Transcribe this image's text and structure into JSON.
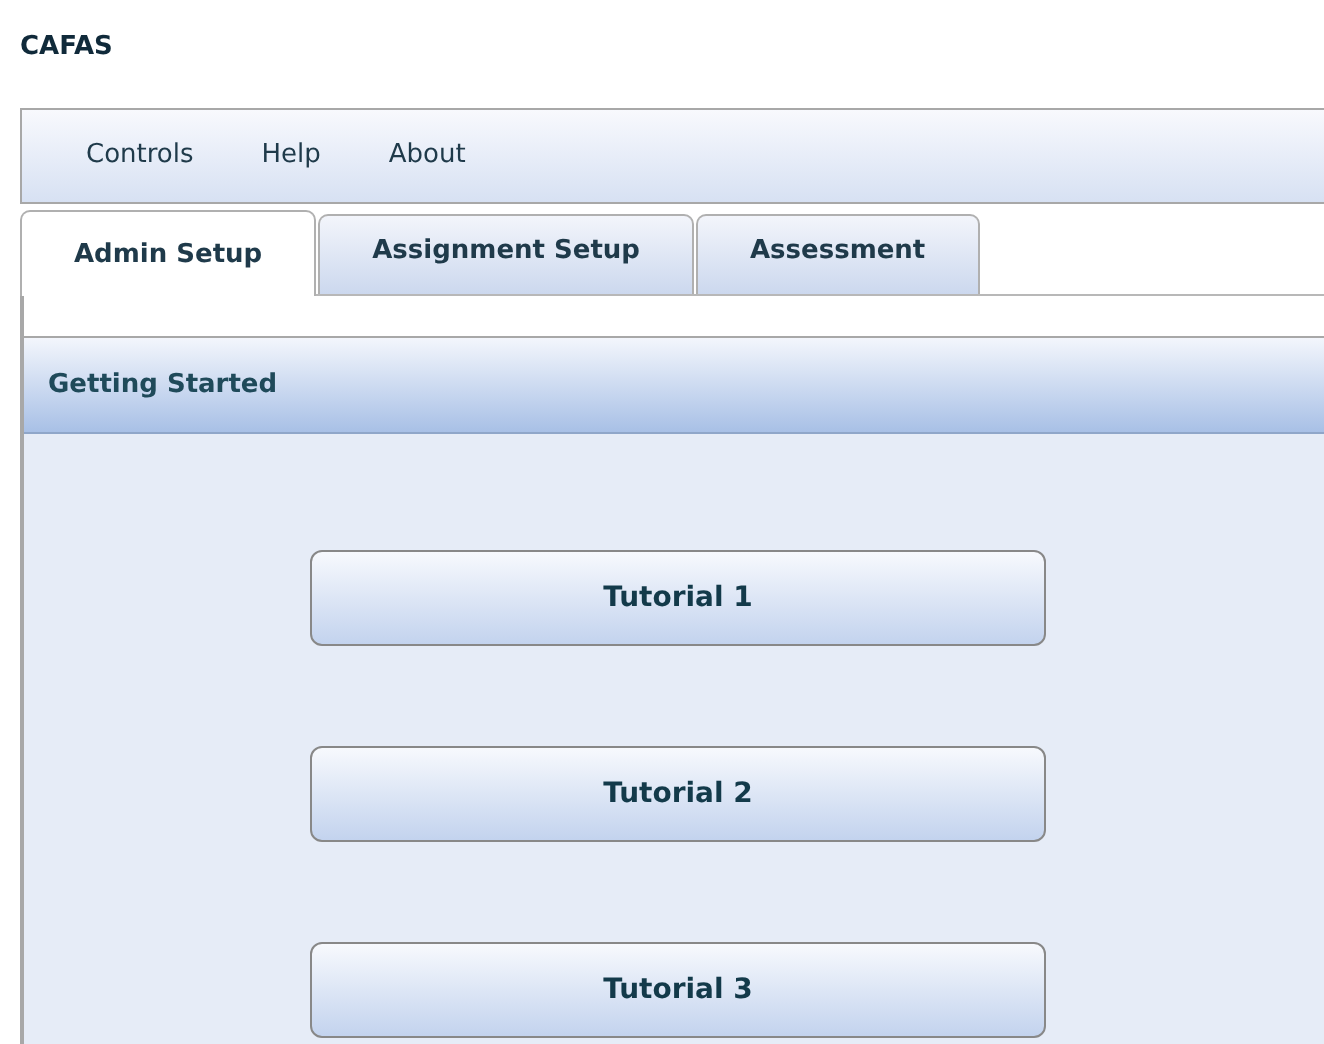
{
  "app_title": "CAFAS",
  "menu": [
    "Controls",
    "Help",
    "About"
  ],
  "tabs": [
    {
      "label": "Admin Setup",
      "selected": true
    },
    {
      "label": "Assignment Setup",
      "selected": false
    },
    {
      "label": "Assessment",
      "selected": false
    }
  ],
  "panel": {
    "title": "Getting Started",
    "buttons": [
      "Tutorial 1",
      "Tutorial 2",
      "Tutorial 3"
    ]
  }
}
